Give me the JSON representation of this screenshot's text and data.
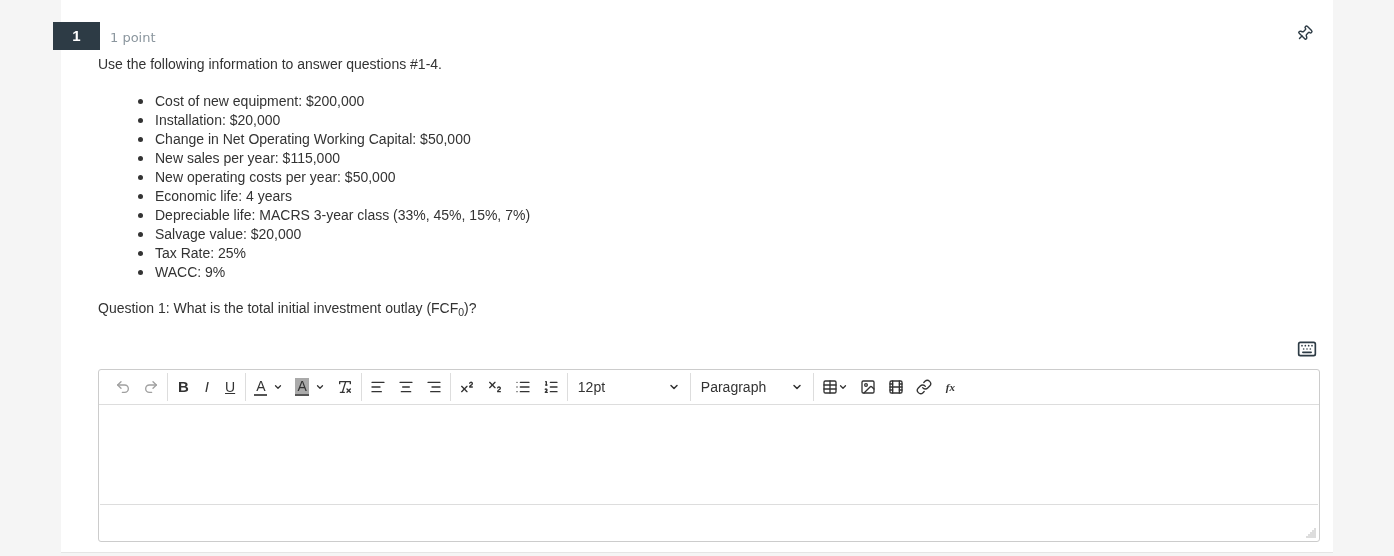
{
  "question": {
    "number": "1",
    "points": "1 point",
    "intro": "Use the following information to answer questions #1-4.",
    "facts": [
      "Cost of new equipment: $200,000",
      "Installation: $20,000",
      "Change in Net Operating Working Capital: $50,000",
      "New sales per year: $115,000",
      "New operating costs per year: $50,000",
      "Economic life: 4 years",
      "Depreciable life: MACRS 3-year class (33%, 45%, 15%, 7%)",
      "Salvage value: $20,000",
      "Tax Rate: 25%",
      "WACC: 9%"
    ],
    "prompt": "Question 1: What is the total initial investment outlay (FCF$_{0}$)?"
  },
  "editor": {
    "toolbar": [
      [
        {
          "kind": "undo",
          "disabled": true
        },
        {
          "kind": "redo",
          "disabled": true
        }
      ],
      [
        {
          "kind": "bold",
          "label": "B",
          "disabled": false
        },
        {
          "kind": "italic",
          "label": "I",
          "disabled": false
        },
        {
          "kind": "underline",
          "label": "U",
          "disabled": false
        }
      ],
      [
        {
          "kind": "textcolor",
          "label": "A",
          "disabled": false
        },
        {
          "kind": "highlight",
          "label": "A",
          "disabled": false
        },
        {
          "kind": "clearformat",
          "disabled": false
        }
      ],
      [
        {
          "kind": "alignleft",
          "disabled": false
        },
        {
          "kind": "aligncenter",
          "disabled": false
        },
        {
          "kind": "alignright",
          "disabled": false
        }
      ],
      [
        {
          "kind": "superscript",
          "disabled": false
        },
        {
          "kind": "subscript",
          "disabled": false
        },
        {
          "kind": "bullets",
          "disabled": false
        },
        {
          "kind": "numbering",
          "disabled": false
        }
      ],
      [
        {
          "kind": "dropdown",
          "label": "12pt",
          "disabled": false
        }
      ],
      [
        {
          "kind": "dropdown",
          "label": "Paragraph",
          "disabled": false
        }
      ],
      [
        {
          "kind": "table",
          "disabled": false
        },
        {
          "kind": "image",
          "disabled": false
        },
        {
          "kind": "media",
          "disabled": false
        },
        {
          "kind": "link",
          "disabled": false
        },
        {
          "kind": "formula",
          "label": "fx",
          "disabled": false
        }
      ]
    ]
  }
}
